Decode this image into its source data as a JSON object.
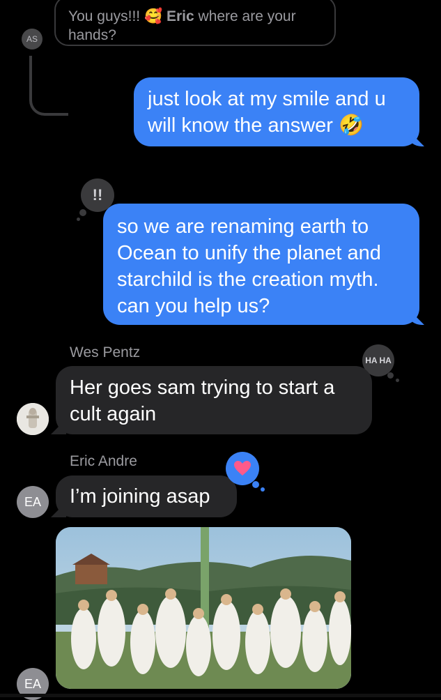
{
  "thread": {
    "quoted_text_prefix": "You guys!!!",
    "quoted_emoji": "🥰",
    "quoted_name": "Eric",
    "quoted_text_suffix": "where are your hands?",
    "quoted_avatar": "AS"
  },
  "messages": [
    {
      "id": "m1",
      "kind": "sent",
      "text": "just look at my smile and u will know the answer 🤣"
    },
    {
      "id": "m2",
      "kind": "sent",
      "text": "so we are renaming earth to Ocean to unify the planet and starchild is the creation myth. can you help us?",
      "tapback": "!!"
    },
    {
      "id": "m3",
      "kind": "received",
      "sender": "Wes Pentz",
      "text": "Her goes sam trying to start a cult again",
      "tapback": "HA HA"
    },
    {
      "id": "m4",
      "kind": "received",
      "sender": "Eric Andre",
      "text": "I’m joining asap",
      "avatar": "EA",
      "tapback_icon": "heart-icon"
    },
    {
      "id": "m5",
      "kind": "received-image",
      "avatar": "EA",
      "image": "festival-photo"
    }
  ],
  "colors": {
    "background": "#000000",
    "sent_bubble": "#3b82f6",
    "received_bubble": "#262628",
    "muted_text": "#9b9ba0",
    "heart": "#ff5a8a"
  }
}
